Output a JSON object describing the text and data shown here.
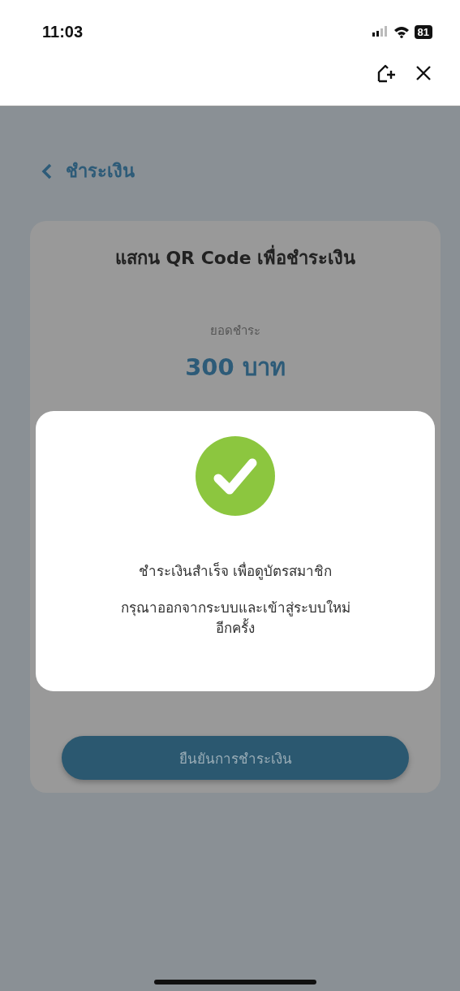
{
  "status_bar": {
    "time": "11:03",
    "battery": "81"
  },
  "header": {
    "back_label": "ชำระเงิน"
  },
  "card": {
    "title": "แสกน QR Code เพื่อชำระเงิน",
    "amount_label": "ยอดชำระ",
    "amount": "300 บาท",
    "confirm_button": "ยืนยันการชำระเงิน"
  },
  "dialog": {
    "message": "ชำระเงินสำเร็จ เพื่อดูบัตรสมาชิก",
    "instruction": "กรุณาออกจากระบบและเข้าสู่ระบบใหม่\nอีกครั้ง"
  }
}
